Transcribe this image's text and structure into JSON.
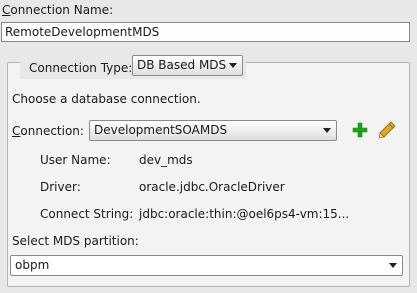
{
  "form": {
    "connection_name_label": "Connection Name:",
    "connection_name_value": "RemoteDevelopmentMDS",
    "connection_type_label": "Connection Type:",
    "connection_type_value": "DB Based MDS",
    "choose_text": "Choose a database connection.",
    "connection_label": "Connection:",
    "connection_value": "DevelopmentSOAMDS",
    "user_name_label": "User Name:",
    "user_name_value": "dev_mds",
    "driver_label": "Driver:",
    "driver_value": "oracle.jdbc.OracleDriver",
    "connect_string_label": "Connect String:",
    "connect_string_value": "jdbc:oracle:thin:@oel6ps4-vm:15...",
    "mds_partition_label": "Select MDS partition:",
    "mds_partition_value": "obpm"
  },
  "icons": {
    "add": "plus-icon",
    "edit": "pencil-icon"
  },
  "colors": {
    "background": "#e8e8e8",
    "group_background": "#f3f3f3",
    "add_icon": "#1fa31f",
    "edit_icon": "#d9a21b"
  }
}
